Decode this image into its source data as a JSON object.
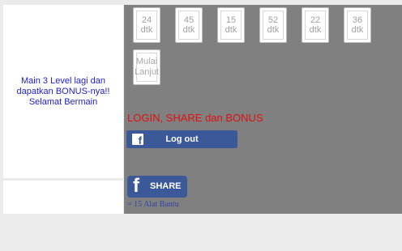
{
  "left": {
    "message_line1": "Main 3 Level lagi dan",
    "message_line2": "dapatkan BONUS-nya!!",
    "message_line3": "Selamat Bermain"
  },
  "levels": [
    {
      "num": "24",
      "unit": "dtk"
    },
    {
      "num": "45",
      "unit": "dtk"
    },
    {
      "num": "15",
      "unit": "dtk"
    },
    {
      "num": "52",
      "unit": "dtk"
    },
    {
      "num": "22",
      "unit": "dtk"
    },
    {
      "num": "36",
      "unit": "dtk"
    }
  ],
  "resume": {
    "line1": "Mulai",
    "line2": "Lanjut"
  },
  "bonus_title": "LOGIN, SHARE dan BONUS",
  "logout_label": "Log out",
  "share_label": "SHARE",
  "alat_bantu": "= 15 Alat Bantu",
  "colors": {
    "facebook_blue": "#3b5998",
    "bonus_red": "#e01010",
    "message_blue": "#2020c8",
    "panel_gray": "#808080"
  }
}
